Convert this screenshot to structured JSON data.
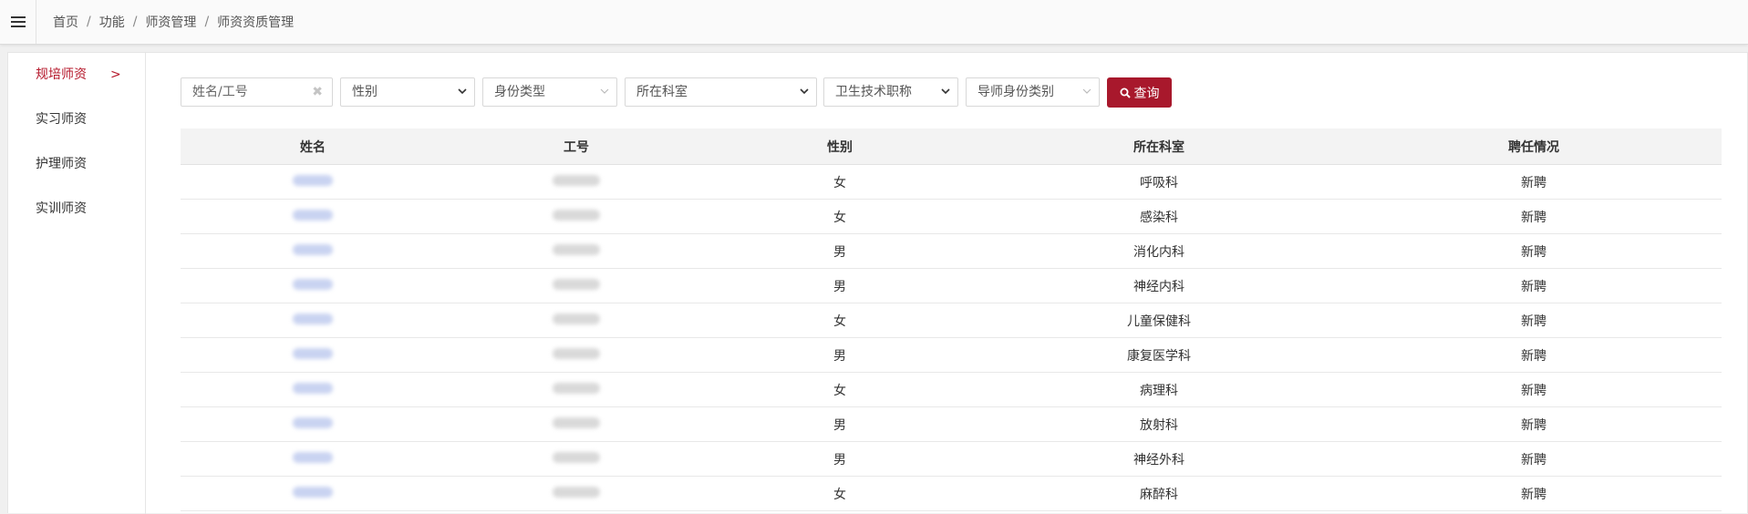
{
  "breadcrumb": [
    "首页",
    "功能",
    "师资管理",
    "师资资质管理"
  ],
  "breadcrumb_separator": "/",
  "sidebar": {
    "items": [
      {
        "label": "规培师资",
        "active": true
      },
      {
        "label": "实习师资",
        "active": false
      },
      {
        "label": "护理师资",
        "active": false
      },
      {
        "label": "实训师资",
        "active": false
      }
    ],
    "active_chevron": ">"
  },
  "filters": {
    "name_placeholder": "姓名/工号",
    "clear_glyph": "✖",
    "gender": "性别",
    "identity_type": "身份类型",
    "department": "所在科室",
    "tech_title": "卫生技术职称",
    "mentor_category": "导师身份类别",
    "search_label": "查询"
  },
  "table": {
    "headers": [
      "姓名",
      "工号",
      "性别",
      "所在科室",
      "聘任情况"
    ],
    "rows": [
      {
        "gender": "女",
        "department": "呼吸科",
        "status": "新聘"
      },
      {
        "gender": "女",
        "department": "感染科",
        "status": "新聘"
      },
      {
        "gender": "男",
        "department": "消化内科",
        "status": "新聘"
      },
      {
        "gender": "男",
        "department": "神经内科",
        "status": "新聘"
      },
      {
        "gender": "女",
        "department": "儿童保健科",
        "status": "新聘"
      },
      {
        "gender": "男",
        "department": "康复医学科",
        "status": "新聘"
      },
      {
        "gender": "女",
        "department": "病理科",
        "status": "新聘"
      },
      {
        "gender": "男",
        "department": "放射科",
        "status": "新聘"
      },
      {
        "gender": "男",
        "department": "神经外科",
        "status": "新聘"
      },
      {
        "gender": "女",
        "department": "麻醉科",
        "status": "新聘"
      }
    ]
  },
  "colors": {
    "accent": "#a8182c",
    "active_text": "#b5182b",
    "header_bg": "#f3f3f3"
  },
  "icons": {
    "menu": "hamburger-icon",
    "search": "magnifier-icon",
    "dropdown": "chevron-down-icon"
  }
}
